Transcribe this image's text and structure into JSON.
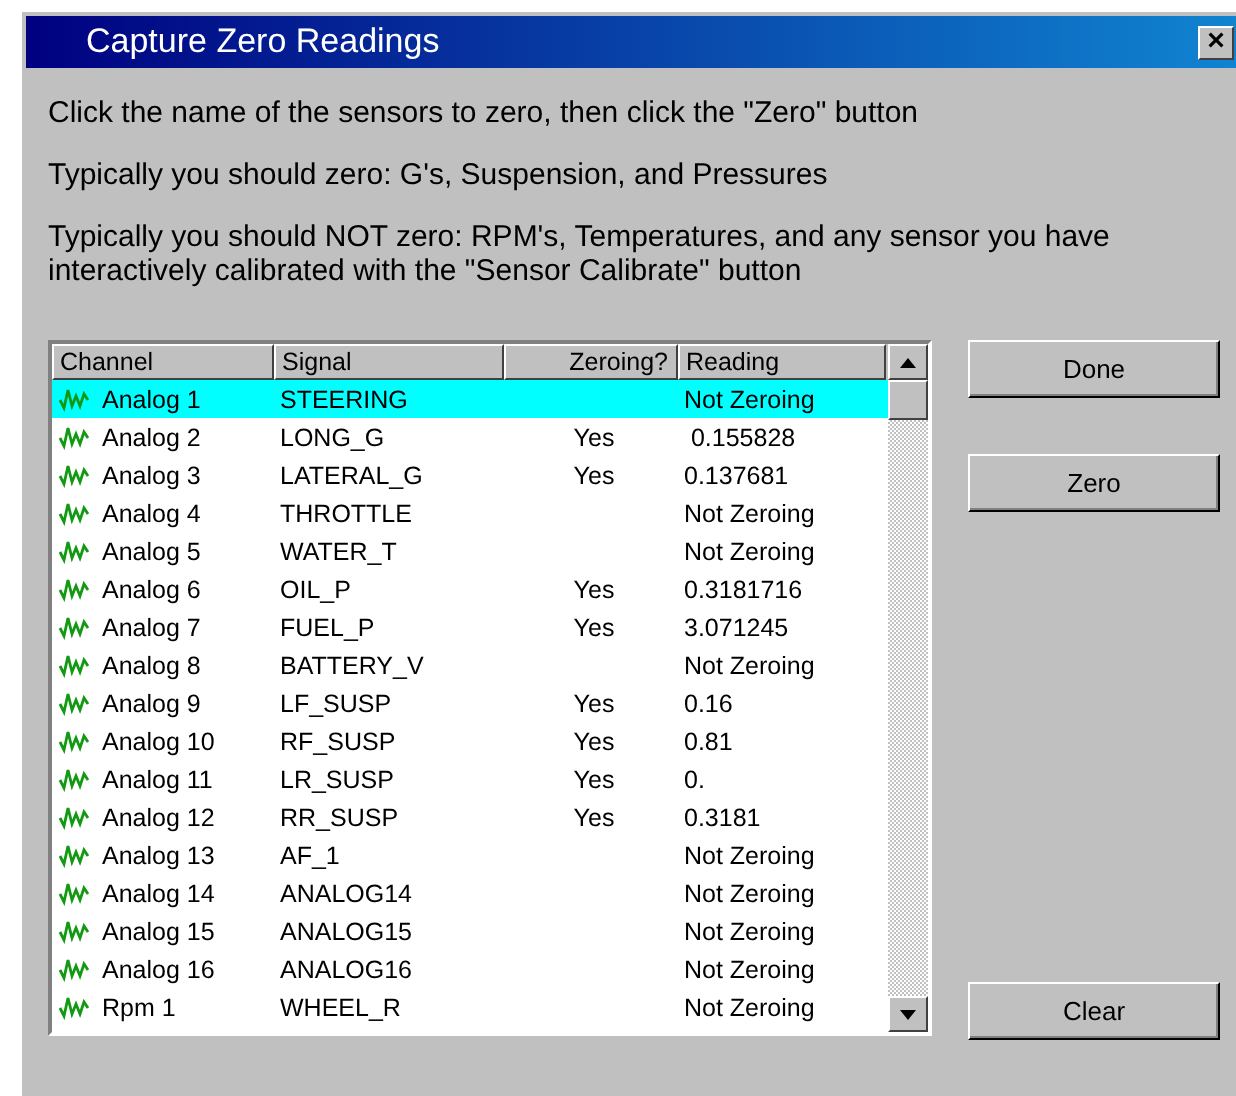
{
  "window": {
    "title": "Capture Zero Readings",
    "close": "×"
  },
  "instructions": [
    "Click the name of the sensors to zero, then click the \"Zero\" button",
    "Typically you should zero:  G's, Suspension, and Pressures",
    "Typically you should NOT zero:  RPM's, Temperatures, and any sensor you have interactively calibrated with the \"Sensor Calibrate\" button"
  ],
  "table": {
    "columns": [
      "Channel",
      "Signal",
      "Zeroing?",
      "Reading"
    ],
    "rows": [
      {
        "channel": "Analog 1",
        "signal": "STEERING",
        "reading": "Not Zeroing",
        "selected": true
      },
      {
        "channel": "Analog 2",
        "signal": "LONG_G",
        "zeroing": "Yes",
        "reading": " 0.155828",
        "selected": false
      },
      {
        "channel": "Analog 3",
        "signal": "LATERAL_G",
        "zeroing": "Yes",
        "reading": "0.137681",
        "selected": false
      },
      {
        "channel": "Analog 4",
        "signal": "THROTTLE",
        "reading": "Not Zeroing",
        "selected": false
      },
      {
        "channel": "Analog 5",
        "signal": "WATER_T",
        "reading": "Not Zeroing",
        "selected": false
      },
      {
        "channel": "Analog 6",
        "signal": "OIL_P",
        "zeroing": "Yes",
        "reading": "0.3181716",
        "selected": false
      },
      {
        "channel": "Analog 7",
        "signal": "FUEL_P",
        "zeroing": "Yes",
        "reading": "3.071245",
        "selected": false
      },
      {
        "channel": "Analog 8",
        "signal": "BATTERY_V",
        "reading": "Not Zeroing",
        "selected": false
      },
      {
        "channel": "Analog 9",
        "signal": "LF_SUSP",
        "zeroing": "Yes",
        "reading": "0.16",
        "selected": false
      },
      {
        "channel": "Analog 10",
        "signal": "RF_SUSP",
        "zeroing": "Yes",
        "reading": "0.81",
        "selected": false
      },
      {
        "channel": "Analog 11",
        "signal": "LR_SUSP",
        "zeroing": "Yes",
        "reading": "0.",
        "selected": false
      },
      {
        "channel": "Analog 12",
        "signal": "RR_SUSP",
        "zeroing": "Yes",
        "reading": "0.3181",
        "selected": false
      },
      {
        "channel": "Analog 13",
        "signal": "AF_1",
        "reading": "Not Zeroing",
        "selected": false
      },
      {
        "channel": "Analog 14",
        "signal": "ANALOG14",
        "reading": "Not Zeroing",
        "selected": false
      },
      {
        "channel": "Analog 15",
        "signal": "ANALOG15",
        "reading": "Not Zeroing",
        "selected": false
      },
      {
        "channel": "Analog 16",
        "signal": "ANALOG16",
        "reading": "Not Zeroing",
        "selected": false
      },
      {
        "channel": "Rpm 1",
        "signal": "WHEEL_R",
        "reading": "Not Zeroing",
        "selected": false
      }
    ]
  },
  "buttons": {
    "top": [
      "Done",
      "Zero"
    ],
    "bottom": [
      "Clear"
    ]
  }
}
